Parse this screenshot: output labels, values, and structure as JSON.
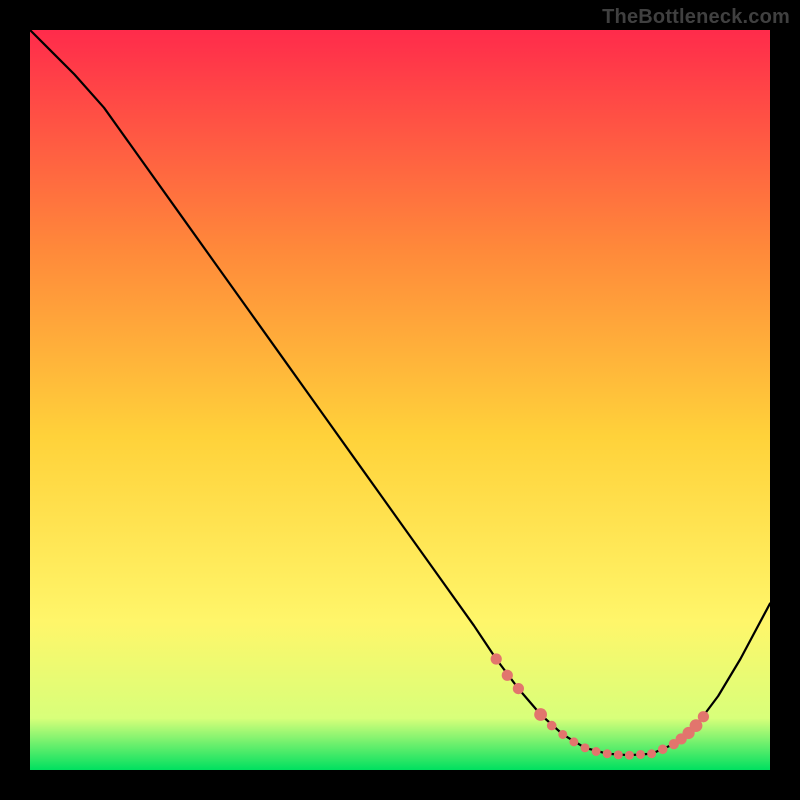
{
  "watermark": "TheBottleneck.com",
  "colors": {
    "background": "#000000",
    "curve": "#000000",
    "marker_fill": "#e2756d",
    "marker_stroke": "#e2756d",
    "gradient_top": "#ff2b4b",
    "gradient_upper_mid": "#ff8a3a",
    "gradient_mid": "#ffd23a",
    "gradient_lower_mid": "#fff66a",
    "gradient_near_bottom": "#d8ff7a",
    "gradient_bottom": "#00e060"
  },
  "chart_data": {
    "type": "line",
    "title": "",
    "xlabel": "",
    "ylabel": "",
    "xlim": [
      0,
      100
    ],
    "ylim": [
      0,
      100
    ],
    "grid": false,
    "legend": false,
    "series": [
      {
        "name": "bottleneck-curve",
        "x": [
          0,
          3,
          6,
          10,
          15,
          20,
          25,
          30,
          35,
          40,
          45,
          50,
          55,
          60,
          63,
          66,
          69,
          72,
          75,
          78,
          81,
          84,
          87,
          90,
          93,
          96,
          100
        ],
        "y": [
          100,
          97,
          94,
          89.5,
          82.5,
          75.5,
          68.5,
          61.5,
          54.5,
          47.5,
          40.5,
          33.5,
          26.5,
          19.5,
          15,
          11,
          7.5,
          4.8,
          3.0,
          2.2,
          2.0,
          2.2,
          3.5,
          6.0,
          10.0,
          15.0,
          22.5
        ]
      }
    ],
    "markers": {
      "name": "highlight-dots",
      "points": [
        {
          "x": 63,
          "y": 15.0,
          "r": 3.5
        },
        {
          "x": 64.5,
          "y": 12.8,
          "r": 3.5
        },
        {
          "x": 66,
          "y": 11.0,
          "r": 3.5
        },
        {
          "x": 69,
          "y": 7.5,
          "r": 4.0
        },
        {
          "x": 70.5,
          "y": 6.0,
          "r": 3.0
        },
        {
          "x": 72,
          "y": 4.8,
          "r": 2.8
        },
        {
          "x": 73.5,
          "y": 3.8,
          "r": 2.8
        },
        {
          "x": 75,
          "y": 3.0,
          "r": 2.8
        },
        {
          "x": 76.5,
          "y": 2.5,
          "r": 2.8
        },
        {
          "x": 78,
          "y": 2.2,
          "r": 2.8
        },
        {
          "x": 79.5,
          "y": 2.05,
          "r": 2.8
        },
        {
          "x": 81,
          "y": 2.0,
          "r": 2.8
        },
        {
          "x": 82.5,
          "y": 2.1,
          "r": 2.8
        },
        {
          "x": 84,
          "y": 2.2,
          "r": 2.8
        },
        {
          "x": 85.5,
          "y": 2.8,
          "r": 3.0
        },
        {
          "x": 87,
          "y": 3.5,
          "r": 3.2
        },
        {
          "x": 88,
          "y": 4.2,
          "r": 3.5
        },
        {
          "x": 89,
          "y": 5.0,
          "r": 3.8
        },
        {
          "x": 90,
          "y": 6.0,
          "r": 4.0
        },
        {
          "x": 91,
          "y": 7.2,
          "r": 3.5
        }
      ]
    }
  }
}
